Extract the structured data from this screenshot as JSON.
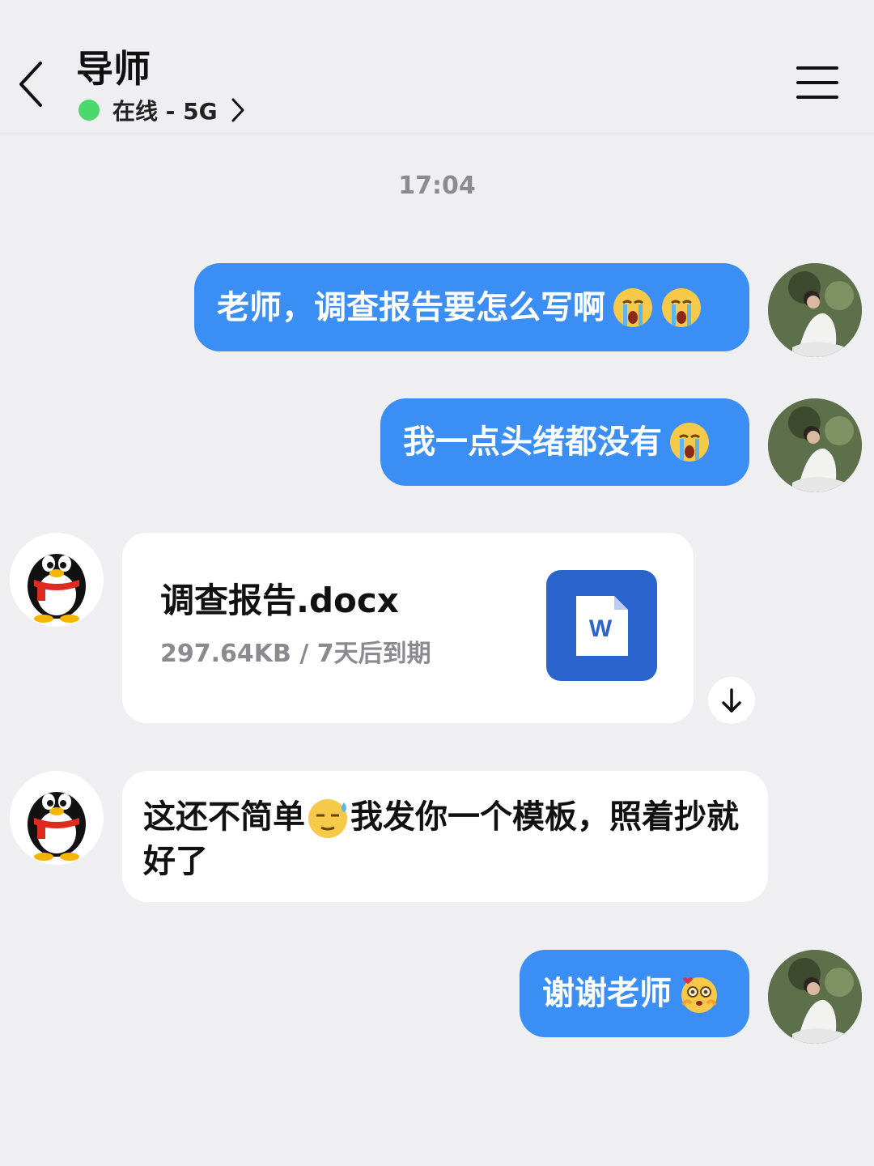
{
  "header": {
    "title": "导师",
    "status": "在线 - 5G",
    "icons": {
      "back": "chevron-left-icon",
      "status_arrow": "chevron-right-icon",
      "menu": "hamburger-menu-icon"
    },
    "status_color": "#4cd96b"
  },
  "timestamp": "17:04",
  "messages": [
    {
      "sender": "me",
      "text": "老师，调查报告要怎么写啊",
      "emojis": [
        "crying-face-icon",
        "crying-face-icon"
      ]
    },
    {
      "sender": "me",
      "text": "我一点头绪都没有",
      "emojis": [
        "crying-face-icon"
      ]
    },
    {
      "sender": "teacher",
      "type": "file",
      "file_name": "调查报告.docx",
      "file_meta": "297.64KB / 7天后到期",
      "file_icon_letter": "W"
    },
    {
      "sender": "teacher",
      "text_before": "这还不简单",
      "text_after": "我发你一个模板，照着抄就好了",
      "emoji": "sweat-smile-face-icon"
    },
    {
      "sender": "me",
      "text": "谢谢老师",
      "emojis": [
        "adoring-face-icon"
      ]
    }
  ],
  "colors": {
    "my_bubble": "#3b8ef3",
    "their_bubble": "#ffffff",
    "background": "#efeff1",
    "word_icon": "#2a64cc"
  }
}
